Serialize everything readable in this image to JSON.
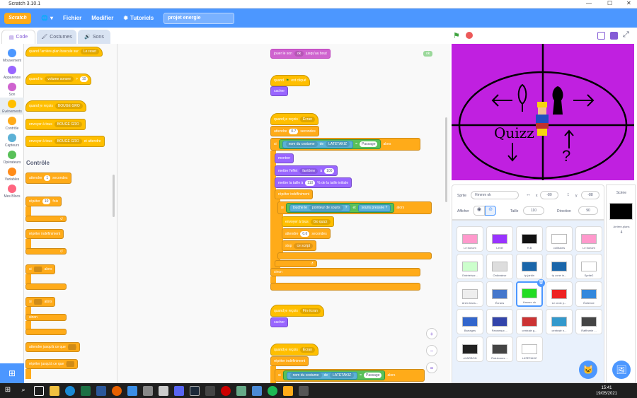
{
  "window": {
    "title": "Scratch 3.10.1",
    "min": "—",
    "max": "☐",
    "close": "✕"
  },
  "menu": {
    "logo": "Scratch",
    "file": "Fichier",
    "edit": "Modifier",
    "tutorials": "Tutoriels",
    "project_title": "projet energie"
  },
  "tabs": {
    "code": "Code",
    "costumes": "Costumes",
    "sounds": "Sons"
  },
  "categories": [
    {
      "label": "Mouvement",
      "color": "#4c97ff"
    },
    {
      "label": "Apparence",
      "color": "#9966ff"
    },
    {
      "label": "Son",
      "color": "#cf63cf"
    },
    {
      "label": "Événements",
      "color": "#ffbf00"
    },
    {
      "label": "Contrôle",
      "color": "#ffab19"
    },
    {
      "label": "Capteurs",
      "color": "#5cb1d6"
    },
    {
      "label": "Opérateurs",
      "color": "#59c059"
    },
    {
      "label": "Variables",
      "color": "#ff8c1a"
    },
    {
      "label": "Mes Blocs",
      "color": "#ff6680"
    }
  ],
  "palette": {
    "b1": "quand l'arrière-plan bascule sur",
    "b1_dd": "Le reset",
    "b2": "quand le",
    "b2_dd": "volume sonore",
    "b2_val": "10",
    "b3": "quand je reçois",
    "b3_dd": "BOUGE GRO",
    "b4": "envoyer à tous",
    "b4_dd": "BOUGE GRO",
    "b5": "envoyer à tous",
    "b5_dd": "BOUGE GRO",
    "b5_tail": "et attendre",
    "section": "Contrôle",
    "c1": "attendre",
    "c1_val": "1",
    "c1_tail": "secondes",
    "c2": "répéter",
    "c2_val": "10",
    "c2_tail": "fois",
    "c3": "répéter indéfiniment",
    "c4": "si",
    "c4_tail": "alors",
    "c5": "si",
    "c5_tail": "alors",
    "c5_else": "sinon",
    "c6": "attendre jusqu'à ce que",
    "c7": "répéter jusqu'à ce que"
  },
  "script": {
    "s0": "jouer le son",
    "s0_dd": "ok",
    "s0_tail": "jusqu'au bout",
    "s0_badge": "ok",
    "s1_hat": "quand",
    "s1_tail": "est cliqué",
    "s1_b": "cacher",
    "s2_hat": "quand je reçois",
    "s2_dd": "Écran",
    "s2_wait": "attendre",
    "s2_wait_val": "0.7",
    "s2_wait_tail": "secondes",
    "s2_if": "si",
    "s2_costume": "nom du costume",
    "s2_of": "de",
    "s2_of_dd": "LATETAKIZ",
    "s2_eq": "=",
    "s2_eq_val": "Passage",
    "s2_then": "alors",
    "s2_show": "montrer",
    "s2_effect": "mettre l'effet",
    "s2_effect_dd": "fantôme",
    "s2_effect_mid": "à",
    "s2_effect_val": "100",
    "s2_size": "mettre la taille à",
    "s2_size_val": "110",
    "s2_size_tail": "% de la taille initiale",
    "s2_forever": "répéter indéfiniment",
    "s2_if2": "si",
    "s2_touch": "touche le",
    "s2_touch_dd": "pointeur de souris",
    "s2_touch_q": "?",
    "s2_and": "et",
    "s2_mouse": "souris pressée ?",
    "s2_then2": "alors",
    "s2_send": "envoyer à tous",
    "s2_send_dd": "Go quizz",
    "s2_wait2": "attendre",
    "s2_wait2_val": "0.6",
    "s2_wait2_tail": "secondes",
    "s2_stop": "stop",
    "s2_stop_dd": "ce script",
    "s2_else": "sinon",
    "s3_hat": "quand je reçois",
    "s3_dd": "Fin écran",
    "s3_b": "cacher",
    "s4_hat": "quand je reçois",
    "s4_dd": "Écran",
    "s4_forever": "répéter indéfiniment",
    "s4_if": "si",
    "s4_costume": "nom du costume",
    "s4_of": "de",
    "s4_of_dd": "LATETAKIZ",
    "s4_eq": "=",
    "s4_eq_val": "Passage",
    "s4_then": "alors"
  },
  "zoom": {
    "in": "+",
    "out": "−",
    "reset": "="
  },
  "stage": {
    "quiz_text": "Quizz",
    "question": "?"
  },
  "sprite_info": {
    "sprite_label": "Sprite",
    "sprite_name": "Hmmm ok",
    "x_label": "x",
    "x_val": "-80",
    "y_label": "y",
    "y_val": "-88",
    "show_label": "Afficher",
    "size_label": "Taille",
    "size_val": "110",
    "dir_label": "Direction",
    "dir_val": "90"
  },
  "sprites": [
    {
      "name": "Le bonom"
    },
    {
      "name": "Level"
    },
    {
      "name": "H.B"
    },
    {
      "name": "collisions"
    },
    {
      "name": "Le bonom"
    },
    {
      "name": "Entrée/sor..."
    },
    {
      "name": "Ordinateur"
    },
    {
      "name": "tp jardin"
    },
    {
      "name": "tp zone in..."
    },
    {
      "name": "Sprite2"
    },
    {
      "name": "Anim trans..."
    },
    {
      "name": "Écrans"
    },
    {
      "name": "Hmmm ok"
    },
    {
      "name": "Le croix p..."
    },
    {
      "name": "Éolienne"
    },
    {
      "name": "Barrages"
    },
    {
      "name": "Panneaux ..."
    },
    {
      "name": "centrale g..."
    },
    {
      "name": "centrale n..."
    },
    {
      "name": "Raffinerie ..."
    },
    {
      "name": "cHARBON"
    },
    {
      "name": "Rotulomes ..."
    },
    {
      "name": "LATETAKIZ"
    }
  ],
  "scene": {
    "title": "Scène",
    "backdrops_label": "Arrière-plans",
    "backdrops_count": "4"
  },
  "taskbar": {
    "time": "15:41",
    "date": "19/05/2021"
  }
}
